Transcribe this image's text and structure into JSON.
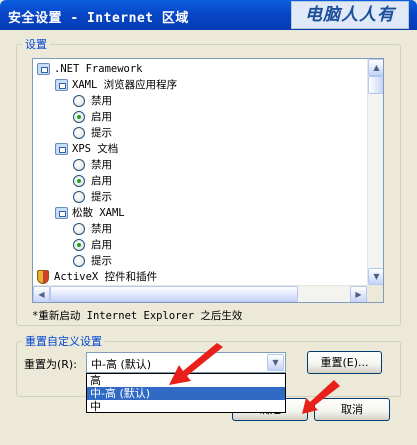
{
  "window": {
    "title": "安全设置 - Internet 区域",
    "watermark": "电脑人人有"
  },
  "settings_group": {
    "label": "设置"
  },
  "tree": [
    {
      "kind": "folder",
      "label": ".NET Framework",
      "level": 0
    },
    {
      "kind": "folder",
      "label": "XAML 浏览器应用程序",
      "level": 1
    },
    {
      "kind": "radio",
      "label": "禁用",
      "checked": false,
      "level": 2
    },
    {
      "kind": "radio",
      "label": "启用",
      "checked": true,
      "level": 2
    },
    {
      "kind": "radio",
      "label": "提示",
      "checked": false,
      "level": 2
    },
    {
      "kind": "folder",
      "label": "XPS 文档",
      "level": 1
    },
    {
      "kind": "radio",
      "label": "禁用",
      "checked": false,
      "level": 2
    },
    {
      "kind": "radio",
      "label": "启用",
      "checked": true,
      "level": 2
    },
    {
      "kind": "radio",
      "label": "提示",
      "checked": false,
      "level": 2
    },
    {
      "kind": "folder",
      "label": "松散 XAML",
      "level": 1
    },
    {
      "kind": "radio",
      "label": "禁用",
      "checked": false,
      "level": 2
    },
    {
      "kind": "radio",
      "label": "启用",
      "checked": true,
      "level": 2
    },
    {
      "kind": "radio",
      "label": "提示",
      "checked": false,
      "level": 2
    },
    {
      "kind": "shield",
      "label": "ActiveX 控件和插件",
      "level": 0
    }
  ],
  "restart_note": "*重新启动 Internet Explorer 之后生效",
  "reset_group": {
    "label": "重置自定义设置",
    "reset_to_label": "重置为(R):",
    "selected_value": "中-高 (默认)",
    "options": [
      "高",
      "中-高 (默认)",
      "中"
    ],
    "selected_index": 1,
    "reset_button": "重置(E)..."
  },
  "buttons": {
    "ok": "确定",
    "cancel": "取消"
  },
  "colors": {
    "title_bar": "#0a5fe0",
    "highlight": "#316ac5",
    "annotation_arrow": "#e8201a"
  },
  "icons": {
    "folder": "settings-folder-icon",
    "shield": "activex-shield-icon",
    "scroll_up": "▲",
    "scroll_down": "▼",
    "scroll_left": "◀",
    "scroll_right": "▶",
    "dropdown": "▼"
  }
}
